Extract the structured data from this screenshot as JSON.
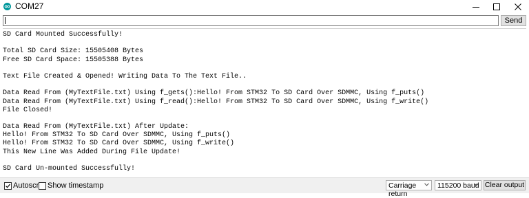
{
  "window": {
    "title": "COM27",
    "app_icon": "arduino-icon",
    "controls": {
      "minimize": "minimize-icon",
      "maximize": "maximize-icon",
      "close": "close-icon"
    }
  },
  "send_bar": {
    "input_value": "",
    "send_label": "Send"
  },
  "serial_output": {
    "lines": [
      "SD Card Mounted Successfully!",
      "",
      "Total SD Card Size: 15505408 Bytes",
      "Free SD Card Space: 15505388 Bytes",
      "",
      "Text File Created & Opened! Writing Data To The Text File..",
      "",
      "Data Read From (MyTextFile.txt) Using f_gets():Hello! From STM32 To SD Card Over SDMMC, Using f_puts()",
      "Data Read From (MyTextFile.txt) Using f_read():Hello! From STM32 To SD Card Over SDMMC, Using f_write()",
      "File Closed!",
      "",
      "Data Read From (MyTextFile.txt) After Update:",
      "Hello! From STM32 To SD Card Over SDMMC, Using f_puts()",
      "Hello! From STM32 To SD Card Over SDMMC, Using f_write()",
      "This New Line Was Added During File Update!",
      "",
      "SD Card Un-mounted Successfully!"
    ]
  },
  "status_bar": {
    "autoscroll": {
      "label": "Autoscroll",
      "checked": true
    },
    "show_timestamp": {
      "label": "Show timestamp",
      "checked": false
    },
    "line_ending": {
      "selected": "Carriage return"
    },
    "baud_rate": {
      "selected": "115200 baud"
    },
    "clear_output_label": "Clear output"
  }
}
